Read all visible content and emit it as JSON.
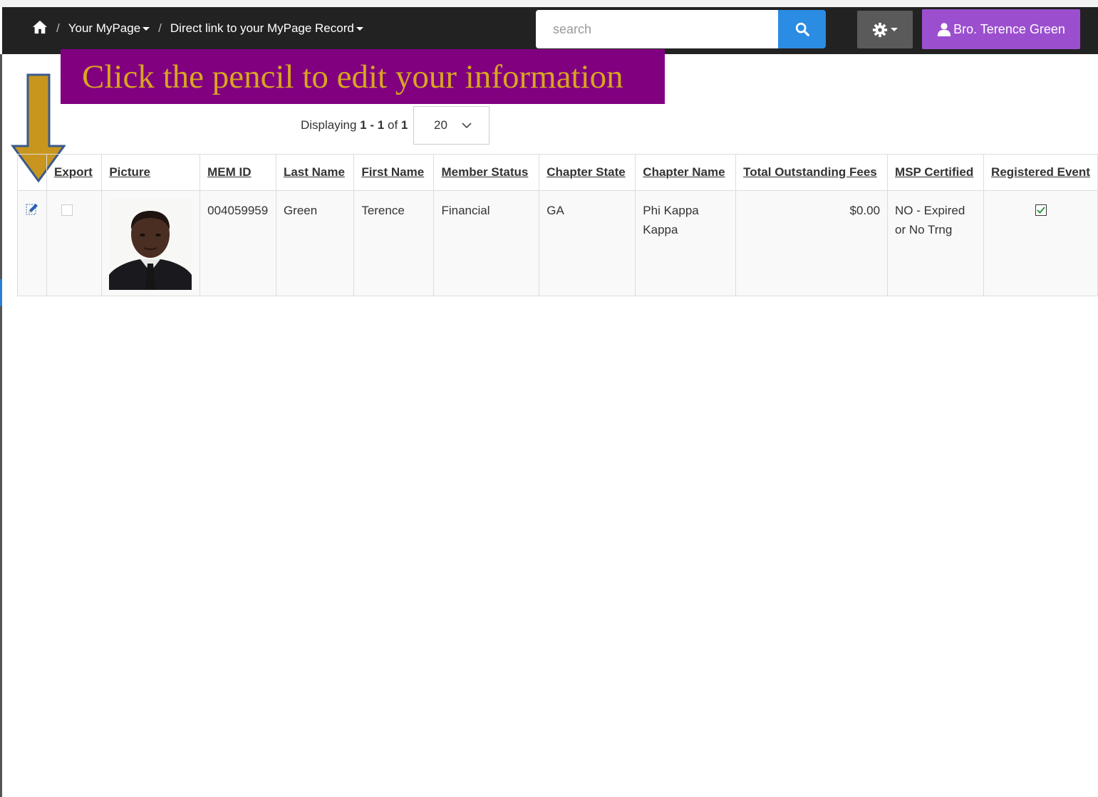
{
  "nav": {
    "crumb1": "Your MyPage",
    "crumb2": "Direct link to your MyPage Record",
    "separator": "/",
    "search_placeholder": "search",
    "user_label": "Bro. Terence Green"
  },
  "annotation": {
    "text": "Click the pencil to edit your information",
    "color": "#800080",
    "text_color": "#d9a520",
    "arrow_color": "#c8961e"
  },
  "pager": {
    "prefix": "Displaying",
    "from": "1",
    "dash": "-",
    "to": "1",
    "of_word": "of",
    "total": "1",
    "per_page": "20"
  },
  "table": {
    "headers": [
      "Export",
      "Picture",
      "MEM ID",
      "Last Name",
      "First Name",
      "Member Status",
      "Chapter State",
      "Chapter Name",
      "Total Outstanding Fees",
      "MSP Certified",
      "Registered Event"
    ],
    "rows": [
      {
        "export_checked": false,
        "mem_id": "004059959",
        "last_name": "Green",
        "first_name": "Terence",
        "member_status": "Financial",
        "chapter_state": "GA",
        "chapter_name": "Phi Kappa Kappa",
        "fees": "$0.00",
        "msp_certified": "NO - Expired or No Trng",
        "registered_event": true
      }
    ]
  },
  "icons": {
    "home": "home-icon",
    "search": "search-icon",
    "gear": "gear-icon",
    "user": "user-icon",
    "edit": "pencil-icon",
    "dropdown": "chevron-down-icon"
  }
}
